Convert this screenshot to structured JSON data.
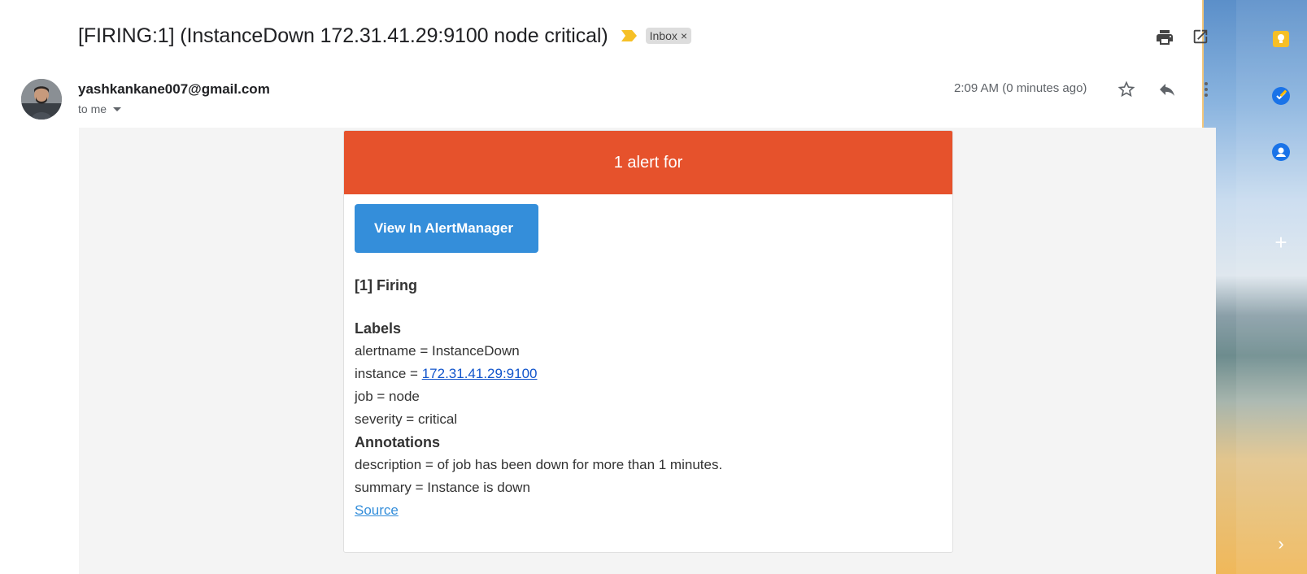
{
  "email": {
    "subject": "[FIRING:1] (InstanceDown 172.31.41.29:9100 node critical)",
    "label_chip": "Inbox",
    "label_chip_close": "×",
    "sender": "yashkankane007@gmail.com",
    "recipient": "to me",
    "timestamp": "2:09 AM (0 minutes ago)"
  },
  "alert": {
    "header": "1 alert for",
    "button_label": "View In AlertManager",
    "firing": "[1] Firing",
    "labels_title": "Labels",
    "labels": {
      "alertname": "alertname = InstanceDown",
      "instance_prefix": "instance = ",
      "instance_value": "172.31.41.29:9100",
      "job": "job = node",
      "severity": "severity = critical"
    },
    "annotations_title": "Annotations",
    "annotations": {
      "description": "description = of job has been down for more than 1 minutes.",
      "summary": "summary = Instance is down"
    },
    "source_link": "Source"
  },
  "colors": {
    "alert_header": "#e6522c",
    "button": "#348eda",
    "link": "#1155cc"
  },
  "icons": [
    "importance-marker-icon",
    "print-icon",
    "open-new-window-icon",
    "star-icon",
    "reply-icon",
    "more-vert-icon",
    "keep-icon",
    "tasks-icon",
    "contacts-icon",
    "add-icon",
    "expand-icon"
  ]
}
